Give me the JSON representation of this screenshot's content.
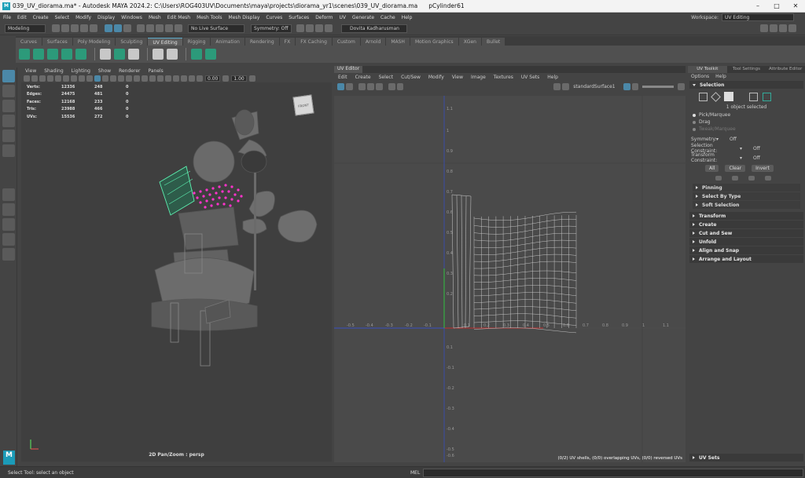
{
  "titlebar": {
    "title": "039_UV_diorama.ma* - Autodesk MAYA 2024.2: C:\\Users\\ROG403UV\\Documents\\maya\\projects\\diorama_yr1\\scenes\\039_UV_diorama.ma",
    "object": "pCylinder61",
    "min": "–",
    "max": "□",
    "close": "✕"
  },
  "menubar": {
    "items": [
      "File",
      "Edit",
      "Create",
      "Select",
      "Modify",
      "Display",
      "Windows",
      "Mesh",
      "Edit Mesh",
      "Mesh Tools",
      "Mesh Display",
      "Curves",
      "Surfaces",
      "Deform",
      "UV",
      "Generate",
      "Cache",
      "Help"
    ],
    "workspace_label": "Workspace:",
    "workspace_value": "UV Editing"
  },
  "statusline": {
    "mode": "Modeling",
    "live_surface": "No Live Surface",
    "symmetry": "Symmetry: Off",
    "user": "Dovita Kadharusman"
  },
  "shelf": {
    "tabs": [
      "Curves",
      "Surfaces",
      "Poly Modeling",
      "Sculpting",
      "UV Editing",
      "Rigging",
      "Animation",
      "Rendering",
      "FX",
      "FX Caching",
      "Custom",
      "Arnold",
      "MASH",
      "Motion Graphics",
      "XGen",
      "Bullet"
    ],
    "active_tab": "UV Editing"
  },
  "viewport": {
    "menu": [
      "View",
      "Shading",
      "Lighting",
      "Show",
      "Renderer",
      "Panels"
    ],
    "field_a": "0.00",
    "field_b": "1.00",
    "hud": [
      {
        "label": "Verts:",
        "v1": "12336",
        "v2": "248",
        "v3": "0"
      },
      {
        "label": "Edges:",
        "v1": "24475",
        "v2": "481",
        "v3": "0"
      },
      {
        "label": "Faces:",
        "v1": "12168",
        "v2": "233",
        "v3": "0"
      },
      {
        "label": "Tris:",
        "v1": "23988",
        "v2": "466",
        "v3": "0"
      },
      {
        "label": "UVs:",
        "v1": "15536",
        "v2": "272",
        "v3": "0"
      }
    ],
    "camera_label": "2D Pan/Zoom : persp",
    "viewcube_label": "FRONT"
  },
  "uv_editor": {
    "tab": "UV Editor",
    "menu": [
      "Edit",
      "Create",
      "Select",
      "Cut/Sew",
      "Modify",
      "View",
      "Image",
      "Textures",
      "UV Sets",
      "Help"
    ],
    "shader": "standardSurface1",
    "axis_x_labels": [
      "-0.5",
      "-0.4",
      "-0.3",
      "-0.2",
      "-0.1",
      "0.1",
      "0.2",
      "0.3",
      "0.4",
      "0.5",
      "0.6",
      "0.7",
      "0.8",
      "0.9",
      "1",
      "1.1"
    ],
    "axis_y_labels": [
      "1.1",
      "1",
      "0.9",
      "0.8",
      "0.7",
      "0.6",
      "0.5",
      "0.4",
      "0.3",
      "0.2",
      "0.1",
      "-0.1",
      "-0.2",
      "-0.3",
      "-0.4",
      "-0.5",
      "-0.6"
    ],
    "status": "(0/2) UV shells, (0/0) overlapping UVs, (0/0) reversed UVs"
  },
  "right_panel": {
    "tabs": [
      "UV Toolkit",
      "Tool Settings",
      "Attribute Editor"
    ],
    "sub": [
      "Options",
      "Help"
    ],
    "selection_header": "Selection",
    "selected_count": "1 object selected",
    "radios": [
      "Pick/Marquee",
      "Drag",
      "Tweak/Marquee"
    ],
    "symmetry_label": "Symmetry:",
    "symmetry_value": "Off",
    "selection_constraint_label": "Selection Constraint:",
    "selection_constraint_value": "Off",
    "transform_constraint_label": "Transform Constraint:",
    "transform_constraint_value": "Off",
    "buttons": [
      "All",
      "Clear",
      "Invert"
    ],
    "subsections": [
      "Pinning",
      "Select By Type",
      "Soft Selection"
    ],
    "sections": [
      "Transform",
      "Create",
      "Cut and Sew",
      "Unfold",
      "Align and Snap",
      "Arrange and Layout"
    ],
    "uv_sets": "UV Sets"
  },
  "bottom": {
    "help_line": "Select Tool: select an object",
    "mel_label": "MEL"
  }
}
